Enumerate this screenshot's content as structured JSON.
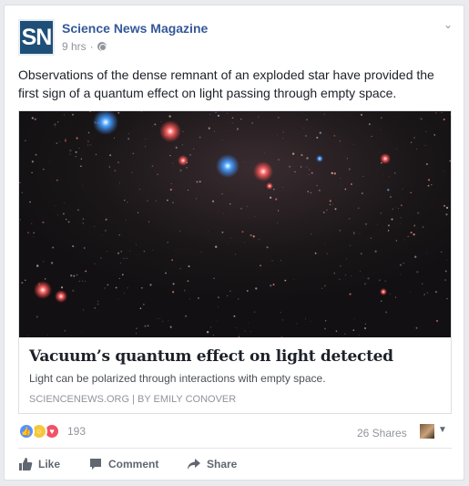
{
  "post": {
    "page_name": "Science News Magazine",
    "avatar_text": "SN",
    "time": "9 hrs",
    "separator": "·",
    "privacy_icon": "globe-icon",
    "menu_icon": "chevron-down-icon",
    "text": "Observations of the dense remnant of an exploded star have provided the first sign of a quantum effect on light passing through empty space."
  },
  "link": {
    "image_alt": "star field with red and blue stars",
    "title": "Vacuum’s quantum effect on light detected",
    "description": "Light can be polarized through interactions with empty space.",
    "source": "SCIENCENEWS.ORG | BY EMILY CONOVER"
  },
  "reactions": {
    "icons": [
      "like-reaction-icon",
      "wow-reaction-icon",
      "love-reaction-icon"
    ],
    "count": "193"
  },
  "shares": "26 Shares",
  "actions": {
    "like": "Like",
    "comment": "Comment",
    "share": "Share"
  },
  "colors": {
    "brand": "#1f4f78",
    "link_blue": "#365899",
    "muted": "#90949c",
    "like_blue": "#5890ff",
    "love_red": "#f25268",
    "wow_yellow": "#f7c73b"
  }
}
